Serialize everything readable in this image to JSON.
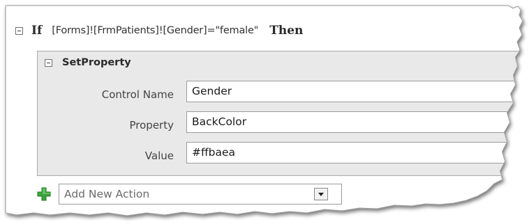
{
  "if_block": {
    "keyword_if": "If",
    "condition": "[Forms]![FrmPatients]![Gender]=\"female\"",
    "keyword_then": "Then"
  },
  "action": {
    "title": "SetProperty",
    "arguments": [
      {
        "label": "Control Name",
        "value": "Gender"
      },
      {
        "label": "Property",
        "value": "BackColor"
      },
      {
        "label": "Value",
        "value": "#ffbaea"
      }
    ]
  },
  "add_action": {
    "text": "Add New Action"
  },
  "icons": {
    "collapse": "collapse-toggle-icon",
    "add": "green-plus-icon",
    "dropdown": "dropdown-arrow-icon"
  },
  "colors": {
    "block_background": "#e9e9e9",
    "plus_green": "#3da53d"
  }
}
